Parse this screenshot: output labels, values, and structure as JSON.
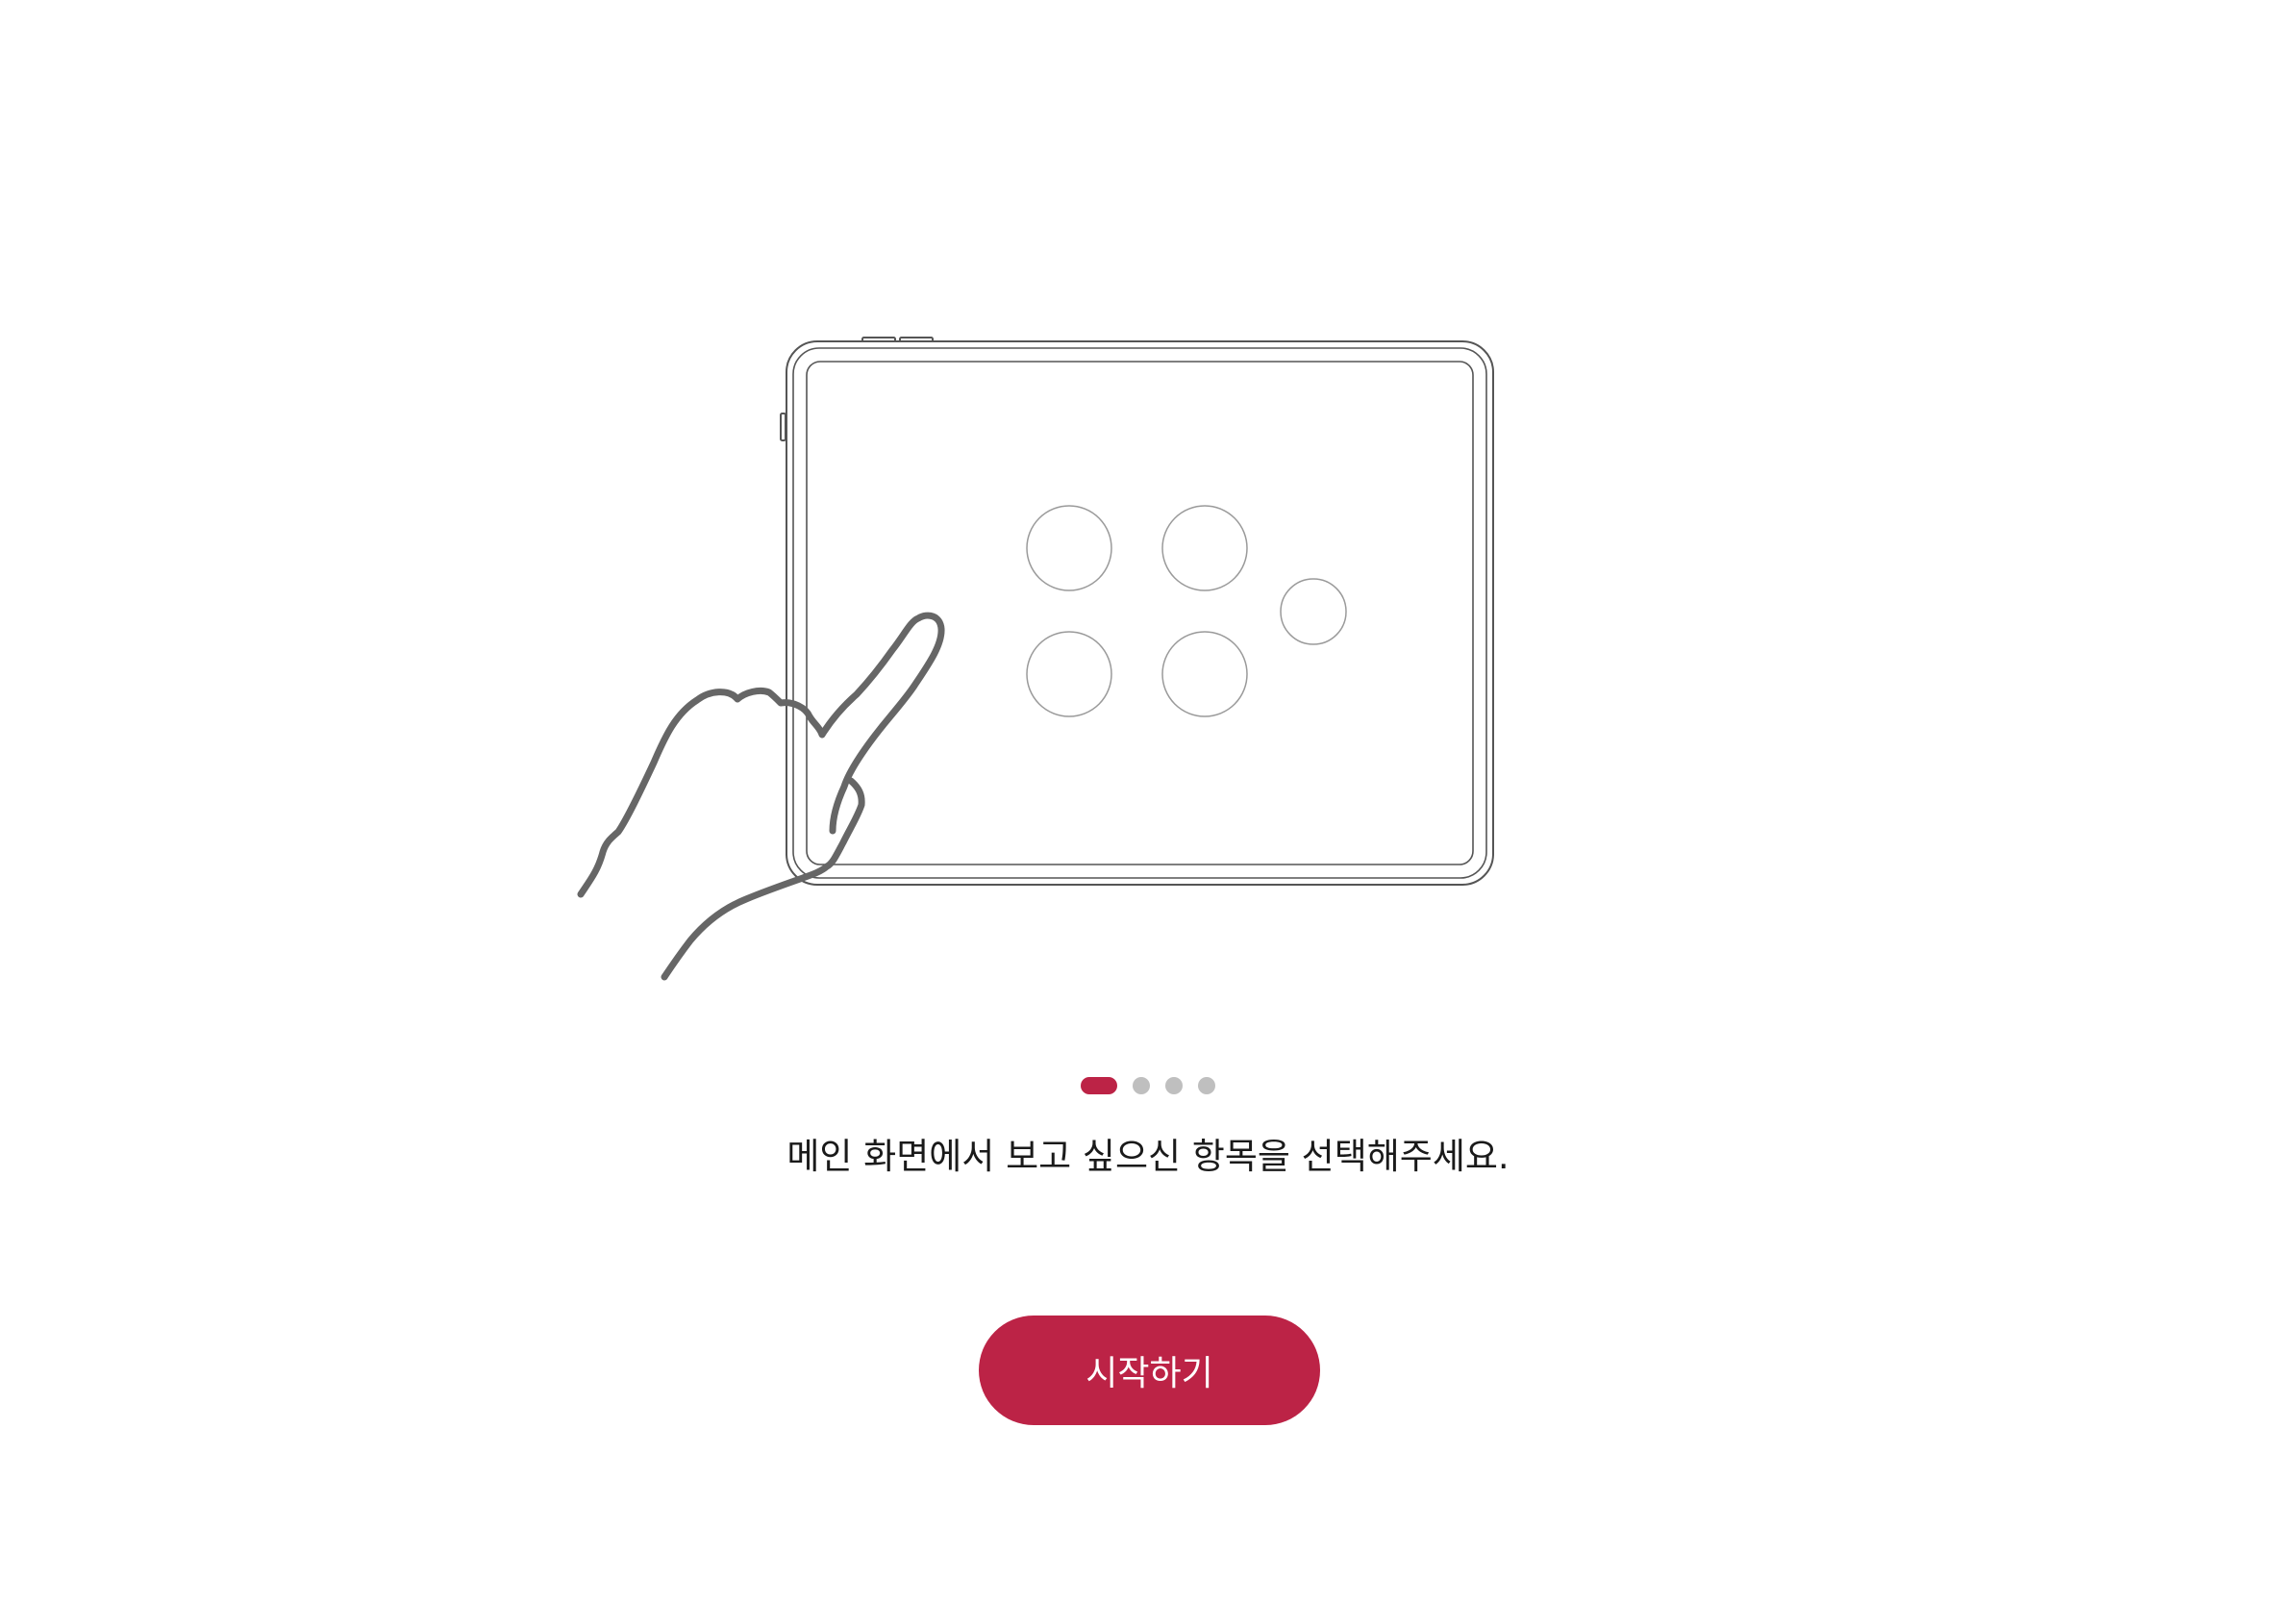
{
  "onboarding": {
    "current_page": 1,
    "total_pages": 4,
    "pager_dots": [
      {
        "state": "active"
      },
      {
        "state": "inactive"
      },
      {
        "state": "inactive"
      },
      {
        "state": "inactive"
      }
    ],
    "message": "메인 화면에서 보고 싶으신 항목을 선택해주세요.",
    "start_button_label": "시작하기",
    "illustration": {
      "device_icon": "tablet-icon",
      "hand_icon": "pointing-hand-icon",
      "tile_count": 5
    }
  },
  "colors": {
    "accent": "#bc2346",
    "dot_inactive": "#bfbfbf",
    "line_dark": "#666666",
    "line_light": "#9a9a9a",
    "text": "#1a1a1a",
    "background": "#ffffff"
  }
}
